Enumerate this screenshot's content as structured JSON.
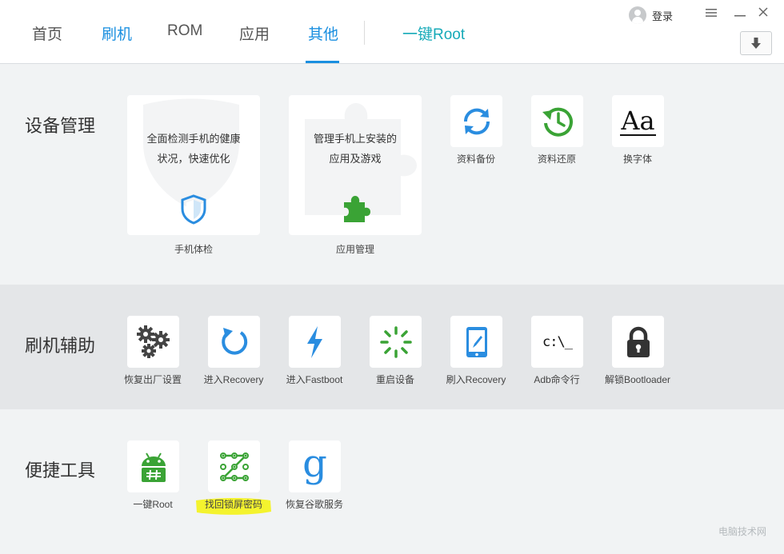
{
  "nav": {
    "tabs": [
      {
        "label": "首页"
      },
      {
        "label": "刷机"
      },
      {
        "label": "ROM"
      },
      {
        "label": "应用"
      },
      {
        "label": "其他"
      }
    ],
    "root": "一键Root",
    "active": "其他"
  },
  "user": {
    "login": "登录"
  },
  "window": {
    "menu": "≡",
    "minimize": "—",
    "close": "✕"
  },
  "sections": {
    "device": {
      "title": "设备管理",
      "cards": [
        {
          "desc1": "全面检测手机的健康",
          "desc2": "状况，快速优化",
          "label": "手机体检",
          "icon": "shield-icon"
        },
        {
          "desc1": "管理手机上安装的",
          "desc2": "应用及游戏",
          "label": "应用管理",
          "icon": "puzzle-icon"
        }
      ],
      "tiles": [
        {
          "label": "资料备份",
          "icon": "sync-icon"
        },
        {
          "label": "资料还原",
          "icon": "restore-icon"
        },
        {
          "label": "换字体",
          "icon": "font-icon",
          "glyph": "Aa"
        }
      ]
    },
    "flash": {
      "title": "刷机辅助",
      "tiles": [
        {
          "label": "恢复出厂设置",
          "icon": "gears-icon"
        },
        {
          "label": "进入Recovery",
          "icon": "refresh-icon"
        },
        {
          "label": "进入Fastboot",
          "icon": "lightning-icon"
        },
        {
          "label": "重启设备",
          "icon": "loading-icon"
        },
        {
          "label": "刷入Recovery",
          "icon": "tablet-icon"
        },
        {
          "label": "Adb命令行",
          "icon": "terminal-icon",
          "glyph": "c:\\_"
        },
        {
          "label": "解锁Bootloader",
          "icon": "lock-icon"
        }
      ]
    },
    "tools": {
      "title": "便捷工具",
      "tiles": [
        {
          "label": "一键Root",
          "icon": "android-icon"
        },
        {
          "label": "找回锁屏密码",
          "icon": "pattern-lock-icon"
        },
        {
          "label": "恢复谷歌服务",
          "icon": "google-icon",
          "glyph": "g"
        }
      ]
    }
  },
  "colors": {
    "accent": "#1a8fe0",
    "root": "#16aab8",
    "green": "#3aa335",
    "highlight": "#f4f20a"
  },
  "watermark": "电脑技术网"
}
